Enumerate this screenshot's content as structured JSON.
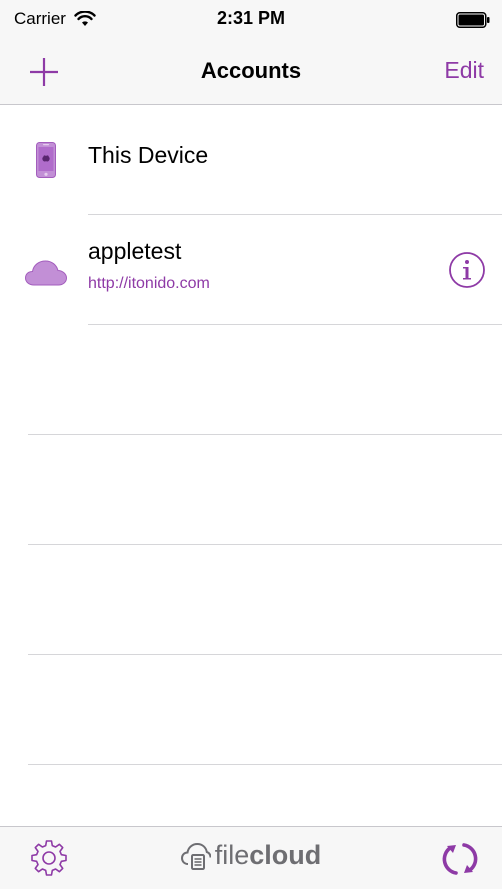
{
  "status_bar": {
    "carrier": "Carrier",
    "time": "2:31 PM"
  },
  "nav": {
    "title": "Accounts",
    "edit_label": "Edit",
    "add_icon": "plus-icon"
  },
  "accounts": [
    {
      "title": "This Device",
      "subtitle": "",
      "icon": "device-phone-icon"
    },
    {
      "title": "appletest",
      "subtitle": "http://itonido.com",
      "icon": "cloud-icon",
      "info_icon": "info-icon"
    }
  ],
  "toolbar": {
    "settings_icon": "gear-icon",
    "logo_light": "file",
    "logo_bold": "cloud",
    "sync_icon": "sync-icon"
  },
  "colors": {
    "accent": "#8e3aa6",
    "icon_light": "#c28fd6",
    "logo_gray": "#6e6e72",
    "bar_bg": "#f7f7f7",
    "separator": "#d6d6d9"
  }
}
